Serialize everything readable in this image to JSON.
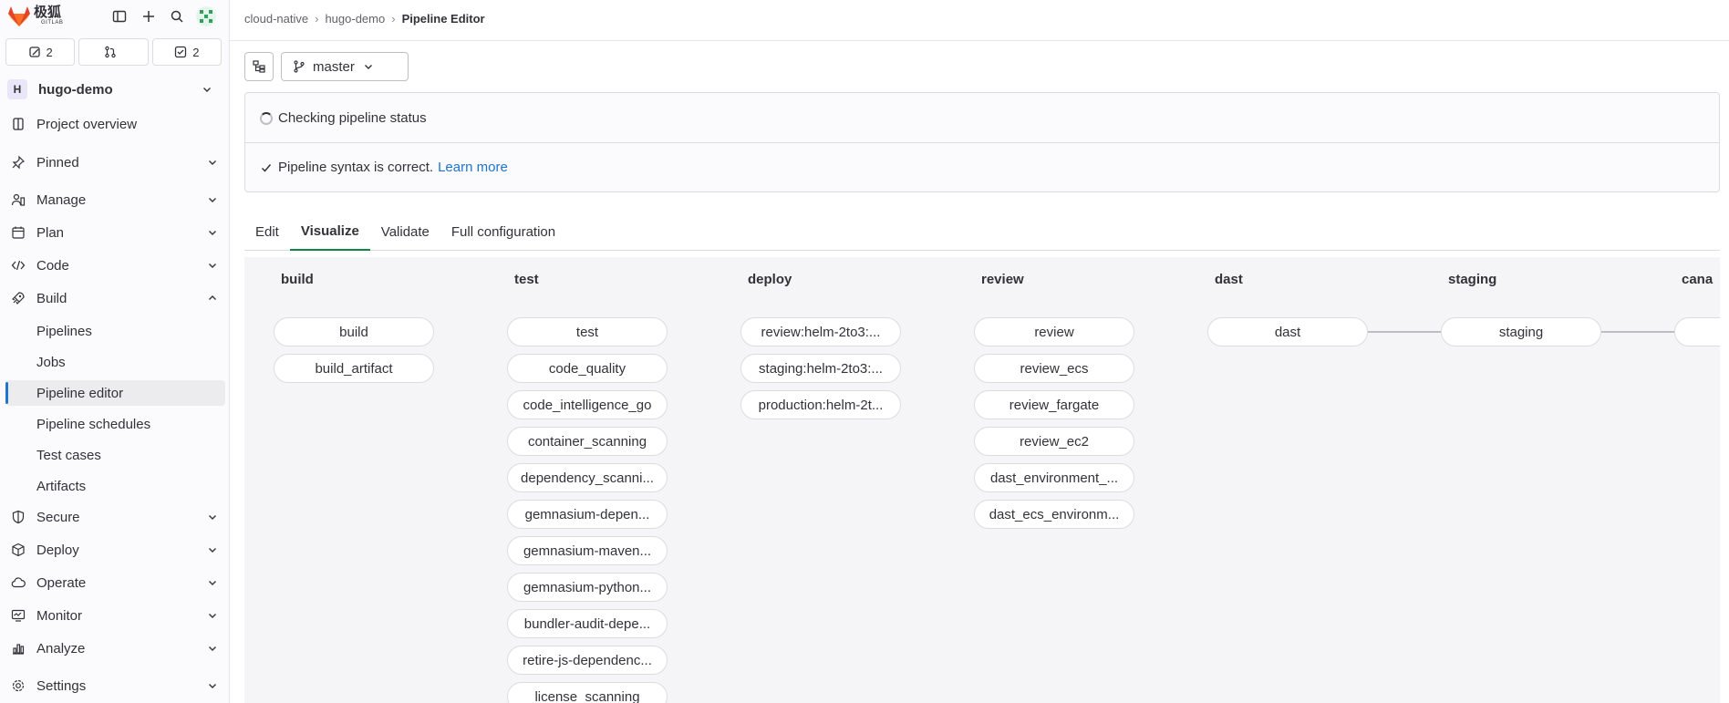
{
  "brand": {
    "name": "极狐",
    "sub": "GITLAB"
  },
  "counters": [
    {
      "icon": "issues-icon",
      "count": "2"
    },
    {
      "icon": "merge-request-icon",
      "count": ""
    },
    {
      "icon": "todo-icon",
      "count": "2"
    }
  ],
  "project": {
    "avatar": "H",
    "name": "hugo-demo"
  },
  "nav": {
    "project_overview": "Project overview",
    "pinned": "Pinned",
    "manage": "Manage",
    "plan": "Plan",
    "code": "Code",
    "build": "Build",
    "build_sub": [
      "Pipelines",
      "Jobs",
      "Pipeline editor",
      "Pipeline schedules",
      "Test cases",
      "Artifacts"
    ],
    "secure": "Secure",
    "deploy": "Deploy",
    "operate": "Operate",
    "monitor": "Monitor",
    "analyze": "Analyze",
    "settings": "Settings"
  },
  "breadcrumb": [
    "cloud-native",
    "hugo-demo",
    "Pipeline Editor"
  ],
  "branch": "master",
  "status": {
    "checking": "Checking pipeline status",
    "syntax": "Pipeline syntax is correct.",
    "learn_more": "Learn more"
  },
  "tabs": [
    "Edit",
    "Visualize",
    "Validate",
    "Full configuration"
  ],
  "stages": [
    {
      "name": "build",
      "jobs": [
        "build",
        "build_artifact"
      ]
    },
    {
      "name": "test",
      "jobs": [
        "test",
        "code_quality",
        "code_intelligence_go",
        "container_scanning",
        "dependency_scanni...",
        "gemnasium-depen...",
        "gemnasium-maven...",
        "gemnasium-python...",
        "bundler-audit-depe...",
        "retire-js-dependenc...",
        "license_scanning"
      ]
    },
    {
      "name": "deploy",
      "jobs": [
        "review:helm-2to3:...",
        "staging:helm-2to3:...",
        "production:helm-2t..."
      ]
    },
    {
      "name": "review",
      "jobs": [
        "review",
        "review_ecs",
        "review_fargate",
        "review_ec2",
        "dast_environment_...",
        "dast_ecs_environm..."
      ]
    },
    {
      "name": "dast",
      "jobs": [
        "dast"
      ]
    },
    {
      "name": "staging",
      "jobs": [
        "staging"
      ]
    },
    {
      "name": "cana",
      "jobs": [
        ""
      ]
    }
  ]
}
